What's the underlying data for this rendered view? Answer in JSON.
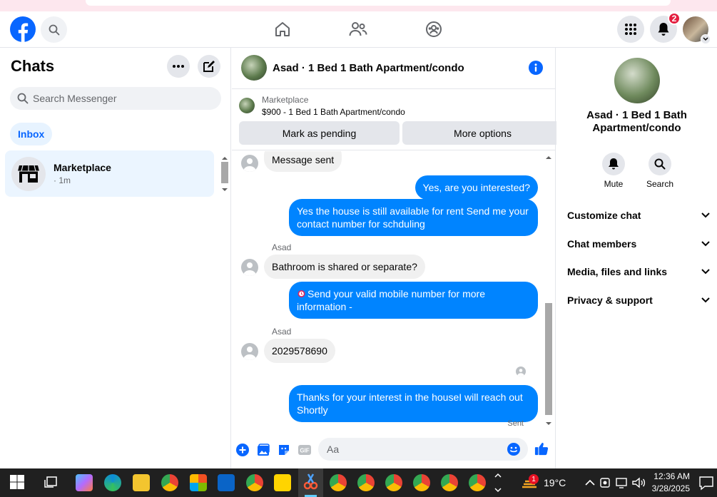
{
  "colors": {
    "brand": "#0866ff",
    "bubble_out": "#0084ff",
    "bubble_in": "#f0f0f0",
    "badge": "#e41e3f",
    "taskbar": "#202020"
  },
  "topnav": {
    "notifications_count": "2"
  },
  "left": {
    "title": "Chats",
    "search_placeholder": "Search Messenger",
    "filter_label": "Inbox",
    "chats": [
      {
        "name": "Marketplace",
        "time": "· 1m"
      }
    ]
  },
  "conversation": {
    "title": "Asad · 1 Bed 1 Bath Apartment/condo",
    "marketplace_label": "Marketplace",
    "listing": "$900 - 1 Bed 1 Bath Apartment/condo",
    "mark_pending_label": "Mark as pending",
    "more_options_label": "More options",
    "messages": [
      {
        "dir": "in",
        "text": "Message sent"
      },
      {
        "dir": "out",
        "text": "Yes, are you interested?"
      },
      {
        "dir": "out",
        "text": "Yes the house is still available for rent Send me your contact number for schduling"
      },
      {
        "dir": "in",
        "sender": "Asad",
        "text": "Bathroom is shared or separate?"
      },
      {
        "dir": "out",
        "text": "Send your valid mobile number for more information -"
      },
      {
        "dir": "in",
        "sender": "Asad",
        "text": "2029578690"
      },
      {
        "dir": "out",
        "text": "Thanks for your interest in the houseI will reach out Shortly"
      }
    ],
    "status": "Sent",
    "composer_placeholder": "Aa"
  },
  "details": {
    "name": "Asad · 1 Bed 1 Bath Apartment/condo",
    "mute_label": "Mute",
    "search_label": "Search",
    "sections": [
      "Customize chat",
      "Chat members",
      "Media, files and links",
      "Privacy & support"
    ]
  },
  "taskbar": {
    "weather_badge": "1",
    "temperature": "19°C",
    "time": "12:36 AM",
    "date": "3/28/2025"
  }
}
